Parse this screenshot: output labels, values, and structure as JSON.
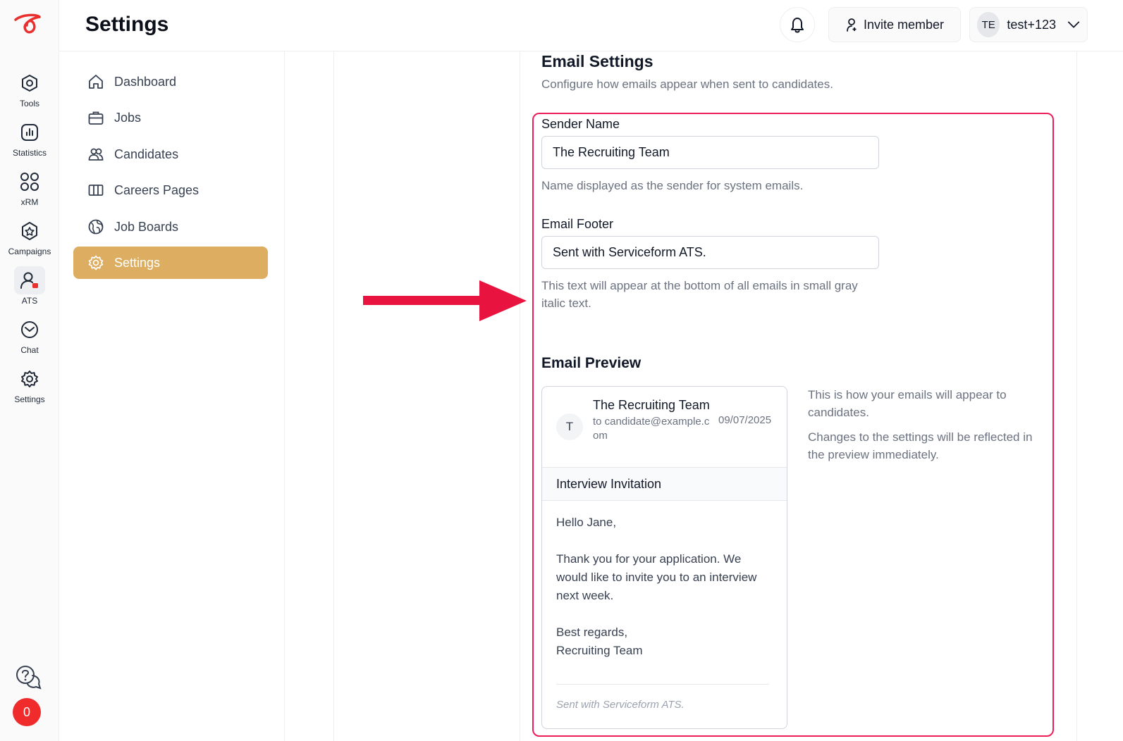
{
  "rail": {
    "items": [
      {
        "label": "Tools",
        "icon": "tools-icon"
      },
      {
        "label": "Statistics",
        "icon": "statistics-icon"
      },
      {
        "label": "xRM",
        "icon": "xrm-icon"
      },
      {
        "label": "Campaigns",
        "icon": "campaigns-icon"
      },
      {
        "label": "ATS",
        "icon": "ats-icon",
        "active": true
      },
      {
        "label": "Chat",
        "icon": "chat-icon"
      },
      {
        "label": "Settings",
        "icon": "settings-icon"
      }
    ],
    "notification_count": "0"
  },
  "header": {
    "title": "Settings",
    "invite_label": "Invite member",
    "user_initials": "TE",
    "user_name": "test+123"
  },
  "subnav": {
    "items": [
      {
        "label": "Dashboard",
        "icon": "home-icon"
      },
      {
        "label": "Jobs",
        "icon": "briefcase-icon"
      },
      {
        "label": "Candidates",
        "icon": "users-icon"
      },
      {
        "label": "Careers Pages",
        "icon": "columns-icon"
      },
      {
        "label": "Job Boards",
        "icon": "globe-icon"
      },
      {
        "label": "Settings",
        "icon": "gear-icon",
        "active": true
      }
    ]
  },
  "email_settings": {
    "title": "Email Settings",
    "description": "Configure how emails appear when sent to candidates.",
    "sender_name_label": "Sender Name",
    "sender_name_value": "The Recruiting Team",
    "sender_name_help": "Name displayed as the sender for system emails.",
    "footer_label": "Email Footer",
    "footer_value": "Sent with Serviceform ATS.",
    "footer_help": "This text will appear at the bottom of all emails in small gray italic text."
  },
  "preview": {
    "title": "Email Preview",
    "avatar_letter": "T",
    "from": "The Recruiting Team",
    "to": "to candidate@example.com",
    "date": "09/07/2025",
    "subject": "Interview Invitation",
    "greeting": "Hello Jane,",
    "body": "Thank you for your application. We would like to invite you to an interview next week.",
    "signoff_1": "Best regards,",
    "signoff_2": "Recruiting Team",
    "footer": "Sent with Serviceform ATS.",
    "note_1": "This is how your emails will appear to candidates.",
    "note_2": "Changes to the settings will be reflected in the preview immediately."
  },
  "colors": {
    "brand": "#e8312f",
    "active_nav": "#ddae61",
    "highlight": "#ec1f5a",
    "arrow": "#e8133f"
  }
}
